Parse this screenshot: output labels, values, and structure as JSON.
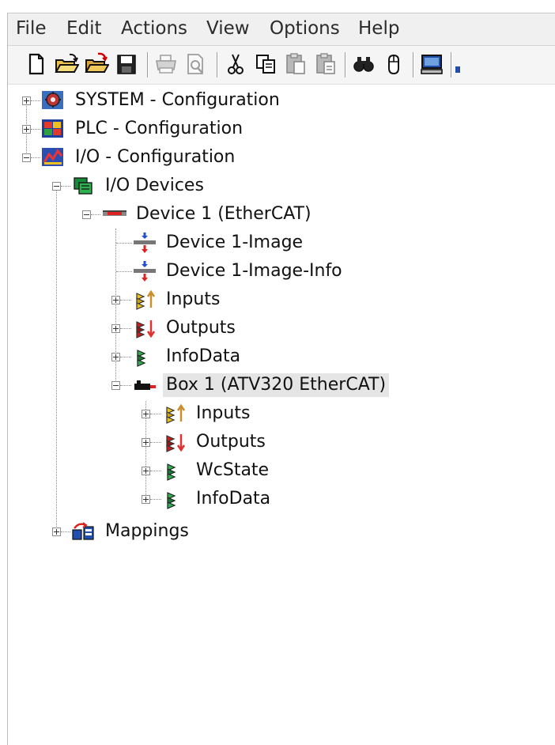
{
  "menu": {
    "items": [
      "File",
      "Edit",
      "Actions",
      "View",
      "Options",
      "Help"
    ]
  },
  "toolbar": {
    "buttons": [
      "new-file-icon",
      "open-folder-icon",
      "open-project-icon",
      "save-icon",
      "print-icon",
      "print-preview-icon",
      "cut-icon",
      "copy-icon",
      "paste-icon",
      "paste-with-links-icon",
      "find-icon",
      "properties-icon",
      "monitor-icon"
    ]
  },
  "tree": {
    "system": "SYSTEM - Configuration",
    "plc": "PLC - Configuration",
    "io": "I/O - Configuration",
    "io_devices": "I/O Devices",
    "device1": "Device 1 (EtherCAT)",
    "device1_image": "Device 1-Image",
    "device1_image_info": "Device 1-Image-Info",
    "inputs": "Inputs",
    "outputs": "Outputs",
    "infodata": "InfoData",
    "box1": "Box 1 (ATV320 EtherCAT)",
    "box_inputs": "Inputs",
    "box_outputs": "Outputs",
    "box_wcstate": "WcState",
    "box_infodata": "InfoData",
    "mappings": "Mappings"
  }
}
